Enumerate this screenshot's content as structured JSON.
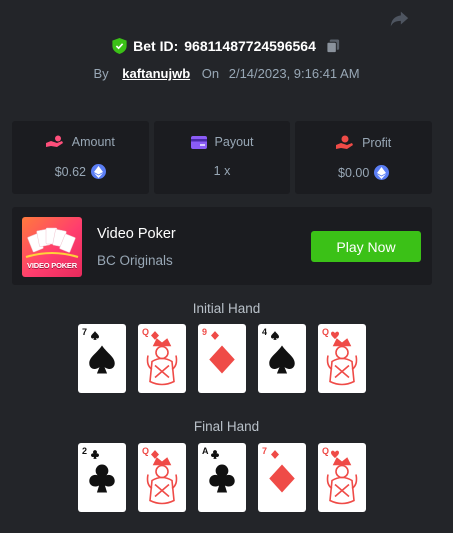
{
  "header": {
    "bet_id_label": "Bet ID:",
    "bet_id": "96811487724596564",
    "by_label": "By",
    "username": "kaftanujwb",
    "on_label": "On",
    "date": "2/14/2023, 9:16:41 AM"
  },
  "stats": [
    {
      "label": "Amount",
      "value": "$0.62",
      "icon": "hand-coins-icon"
    },
    {
      "label": "Payout",
      "value": "1 x",
      "icon": "card-payout-icon"
    },
    {
      "label": "Profit",
      "value": "$0.00",
      "icon": "hand-profit-icon"
    }
  ],
  "game": {
    "title": "Video Poker",
    "provider": "BC Originals",
    "thumb_text": "VIDEO POKER",
    "play_label": "Play Now"
  },
  "initial_hand": {
    "title": "Initial Hand",
    "cards": [
      {
        "rank": "7",
        "suit": "spade"
      },
      {
        "rank": "Q",
        "suit": "diamond"
      },
      {
        "rank": "9",
        "suit": "diamond"
      },
      {
        "rank": "4",
        "suit": "spade"
      },
      {
        "rank": "Q",
        "suit": "heart"
      }
    ]
  },
  "final_hand": {
    "title": "Final Hand",
    "cards": [
      {
        "rank": "2",
        "suit": "club"
      },
      {
        "rank": "Q",
        "suit": "diamond"
      },
      {
        "rank": "A",
        "suit": "club"
      },
      {
        "rank": "7",
        "suit": "diamond"
      },
      {
        "rank": "Q",
        "suit": "heart"
      }
    ]
  },
  "colors": {
    "background": "#232529",
    "panel": "#1b1c20",
    "accent_green": "#3bc117",
    "red_suit": "#ef4b47",
    "black_suit": "#111111"
  }
}
